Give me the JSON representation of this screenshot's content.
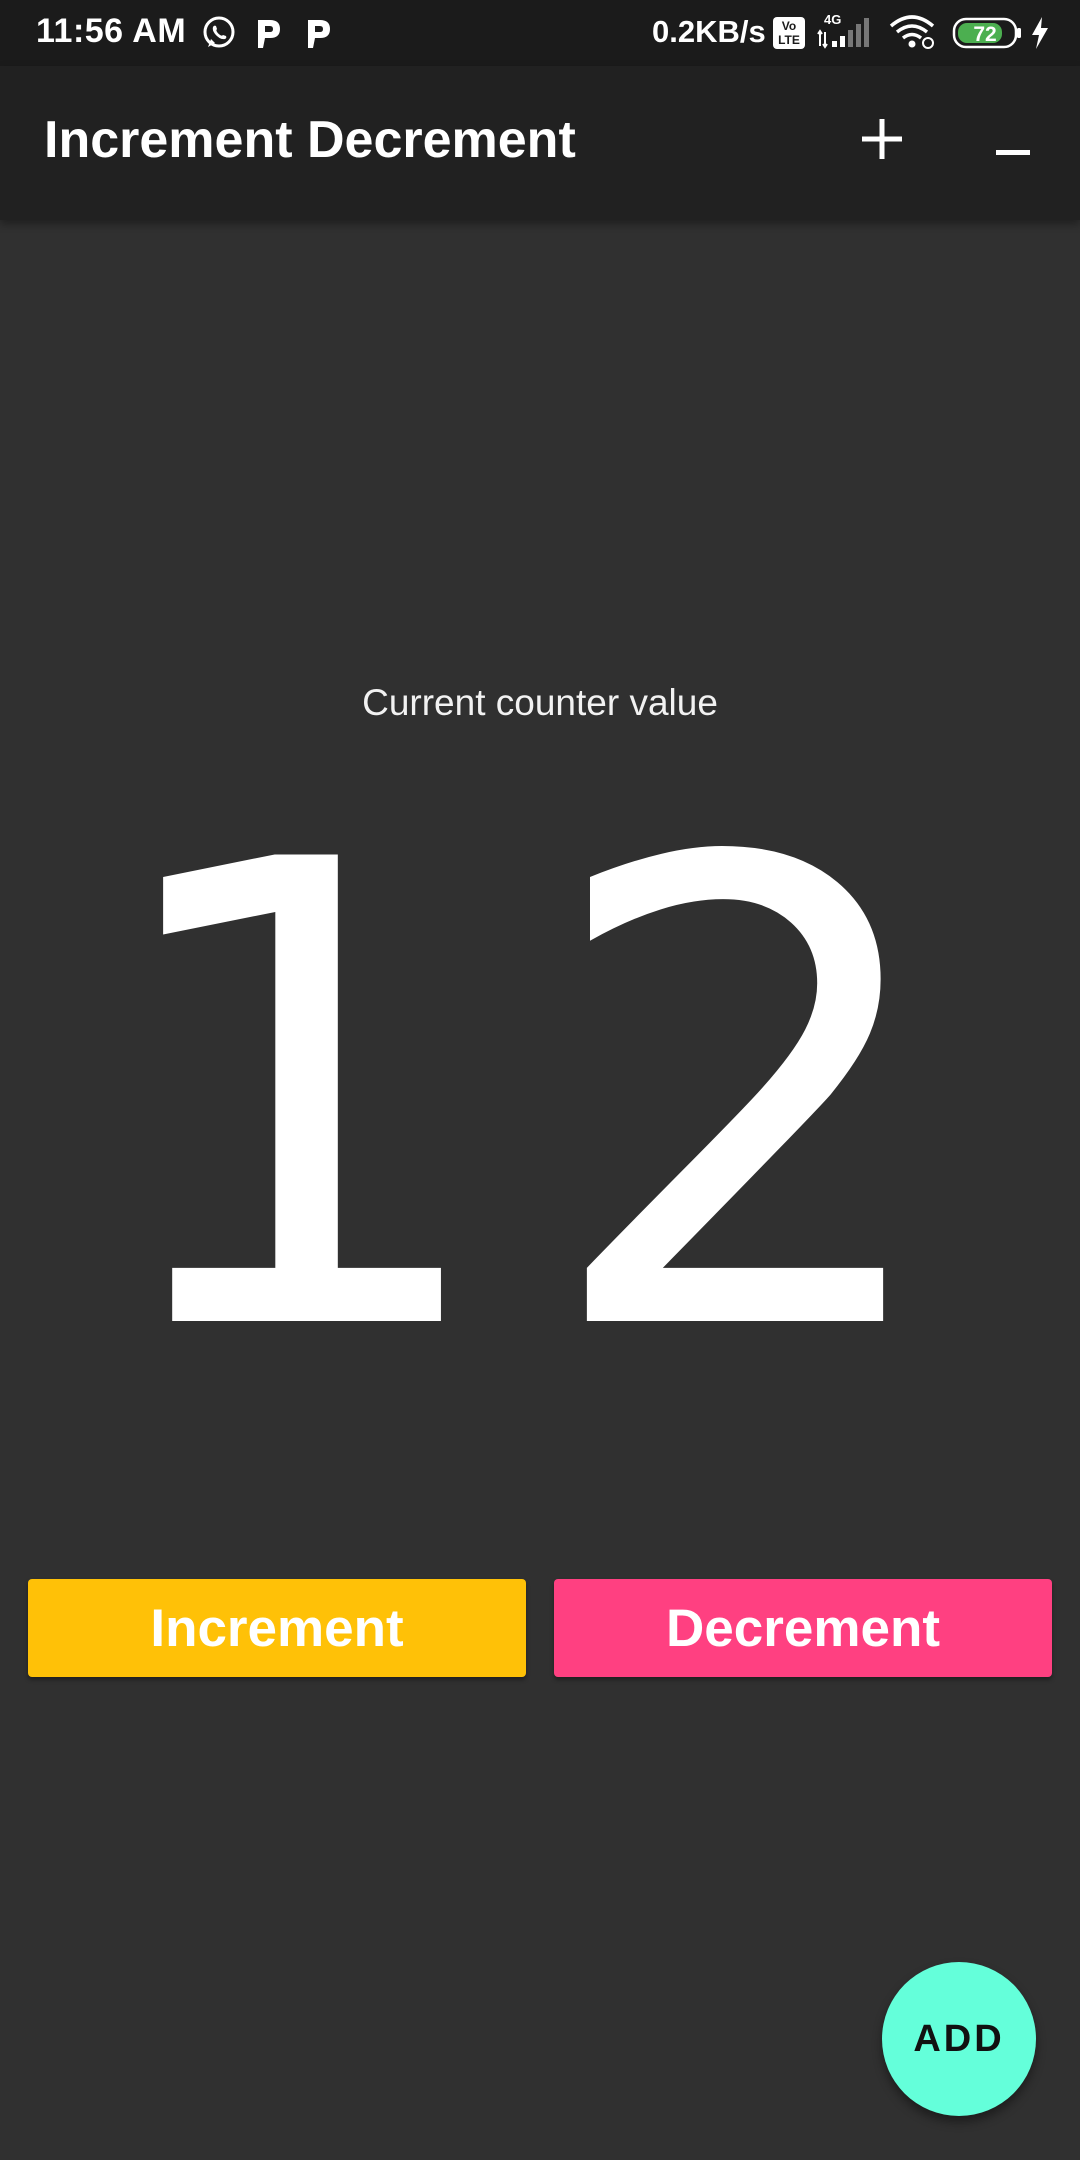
{
  "status_bar": {
    "time": "11:56 AM",
    "network_speed": "0.2KB/s",
    "network_type": "4G",
    "volte_label_top": "Vo",
    "volte_label_bottom": "LTE",
    "battery_level": "72",
    "icons": [
      "whatsapp-icon",
      "parking-p-icon",
      "parking-p-icon",
      "volte-icon",
      "signal-icon",
      "wifi-icon",
      "battery-icon",
      "charging-bolt-icon"
    ]
  },
  "app_bar": {
    "title": "Increment Decrement",
    "actions": [
      {
        "name": "plus-action",
        "icon": "plus-icon"
      },
      {
        "name": "minus-action",
        "icon": "minus-icon"
      }
    ]
  },
  "counter": {
    "label": "Current counter value",
    "value": "12"
  },
  "buttons": {
    "increment": "Increment",
    "decrement": "Decrement"
  },
  "fab": {
    "label": "ADD"
  },
  "colors": {
    "background": "#303030",
    "app_bar": "#212121",
    "status_bar": "#1b1b1b",
    "increment": "#ffc107",
    "decrement": "#ff4081",
    "fab": "#64ffda",
    "battery_fill": "#4caf50"
  }
}
